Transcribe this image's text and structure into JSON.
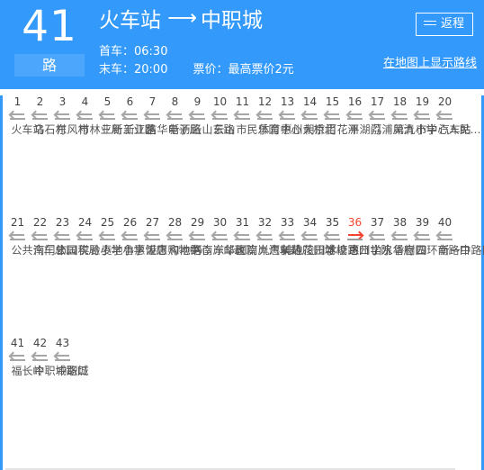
{
  "header": {
    "route_number": "41",
    "route_unit": "路",
    "origin": "火车站",
    "destination": "中职城",
    "direction_arrow": "⟶",
    "first_bus_label": "首车：06:30",
    "last_bus_label": "末车：20:00",
    "fare_label": "票价：最高票价2元",
    "return_button_label": "返程",
    "return_button_icon": "swap-arrows-icon",
    "map_link_label": "在地图上显示路线",
    "background_color": "#3399fa",
    "unit_badge_color": "#4ca6fb"
  },
  "stops": {
    "current_index": 36,
    "current_color": "#f4432e",
    "marker_color": "#a6a6a6",
    "rows": [
      [
        {
          "num": "1",
          "name": "火车站"
        },
        {
          "num": "2",
          "name": "乌石村"
        },
        {
          "num": "3",
          "name": "东风村"
        },
        {
          "num": "4",
          "name": "市林业局"
        },
        {
          "num": "5",
          "name": "三新工业区"
        },
        {
          "num": "6",
          "name": "新江路"
        },
        {
          "num": "7",
          "name": "信华电子厂"
        },
        {
          "num": "8",
          "name": "新沥路"
        },
        {
          "num": "9",
          "name": "云山东路"
        },
        {
          "num": "10",
          "name": "云山"
        },
        {
          "num": "11",
          "name": "市民乐园"
        },
        {
          "num": "12",
          "name": "体育中心"
        },
        {
          "num": "13",
          "name": "惠州大桥北"
        },
        {
          "num": "14",
          "name": "朝京门"
        },
        {
          "num": "15",
          "name": "百花洲"
        },
        {
          "num": "16",
          "name": "平湖门"
        },
        {
          "num": "17",
          "name": "荔浦风清"
        },
        {
          "num": "18",
          "name": "第九小学"
        },
        {
          "num": "19",
          "name": "市中心人民…"
        },
        {
          "num": "20",
          "name": "汽车站"
        }
      ],
      [
        {
          "num": "21",
          "name": "公共汽车总…"
        },
        {
          "num": "22",
          "name": "南门公园"
        },
        {
          "num": "23",
          "name": "市国税局"
        },
        {
          "num": "24",
          "name": "实验小学"
        },
        {
          "num": "25",
          "name": "麦地小学"
        },
        {
          "num": "26",
          "name": "鲁惠饭店"
        },
        {
          "num": "27",
          "name": "港惠购物中心"
        },
        {
          "num": "28",
          "name": "和地路"
        },
        {
          "num": "29",
          "name": "河南岸邮政…"
        },
        {
          "num": "30",
          "name": "东华医院"
        },
        {
          "num": "31",
          "name": "河南岸汽车站"
        },
        {
          "num": "32",
          "name": "九惠制药厂"
        },
        {
          "num": "33",
          "name": "美地花园城"
        },
        {
          "num": "34",
          "name": "凌田学校"
        },
        {
          "num": "35",
          "name": "冰塘路口"
        },
        {
          "num": "36",
          "name": "惠州学院",
          "current": true
        },
        {
          "num": "37",
          "name": "山水华府"
        },
        {
          "num": "38",
          "name": "香樹园"
        },
        {
          "num": "39",
          "name": "四环南路口"
        },
        {
          "num": "40",
          "name": "新一中路口"
        }
      ],
      [
        {
          "num": "41",
          "name": "福长岭"
        },
        {
          "num": "42",
          "name": "中职城路口"
        },
        {
          "num": "43",
          "name": "中职城"
        }
      ]
    ]
  }
}
